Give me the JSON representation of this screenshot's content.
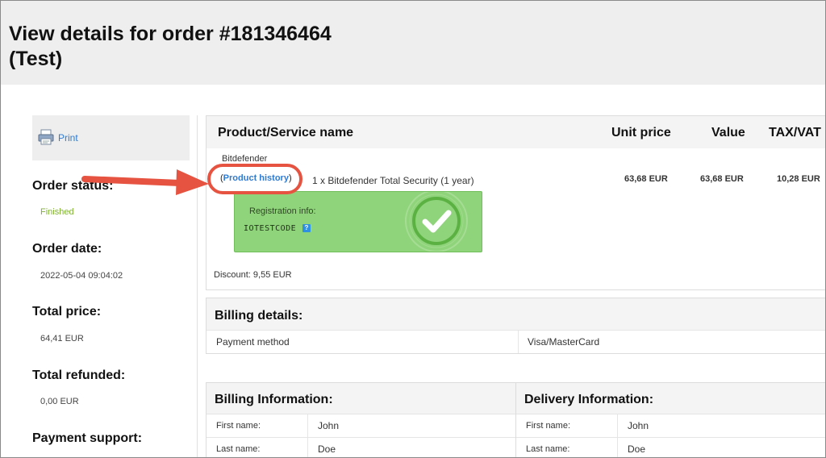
{
  "page": {
    "title_line1": "View details for order #181346464",
    "title_line2": "(Test)"
  },
  "sidebar": {
    "print_label": "Print",
    "order_status_label": "Order status:",
    "order_status_value": "Finished",
    "order_date_label": "Order date:",
    "order_date_value": "2022-05-04 09:04:02",
    "total_price_label": "Total price:",
    "total_price_value": "64,41 EUR",
    "total_refunded_label": "Total refunded:",
    "total_refunded_value": "0,00 EUR",
    "payment_support_label": "Payment support:"
  },
  "products": {
    "headers": {
      "name": "Product/Service name",
      "unit_price": "Unit price",
      "value": "Value",
      "tax": "TAX/VAT"
    },
    "vendor": "Bitdefender",
    "product_history_link": "Product history",
    "quantity_prefix": "1 x",
    "product_name": "Bitdefender Total Security (1 year)",
    "unit_price": "63,68 EUR",
    "value": "63,68 EUR",
    "tax": "10,28 EUR",
    "registration_label": "Registration info:",
    "registration_code": "IOTESTCODE",
    "discount": "Discount: 9,55 EUR"
  },
  "billing_details": {
    "title": "Billing details:",
    "payment_method_label": "Payment method",
    "payment_method_value": "Visa/MasterCard"
  },
  "billing_info": {
    "title": "Billing Information:",
    "first_name_label": "First name:",
    "first_name_value": "John",
    "last_name_label": "Last name:",
    "last_name_value": "Doe"
  },
  "delivery_info": {
    "title": "Delivery Information:",
    "first_name_label": "First name:",
    "first_name_value": "John",
    "last_name_label": "Last name:",
    "last_name_value": "Doe"
  },
  "colors": {
    "accent_link": "#2f7bd1",
    "status_green": "#7fb135",
    "highlight_red": "#e65340",
    "registration_green": "#8fd37b"
  },
  "icons": [
    "printer-icon",
    "help-icon",
    "checkmark-icon",
    "annotation-arrow"
  ]
}
